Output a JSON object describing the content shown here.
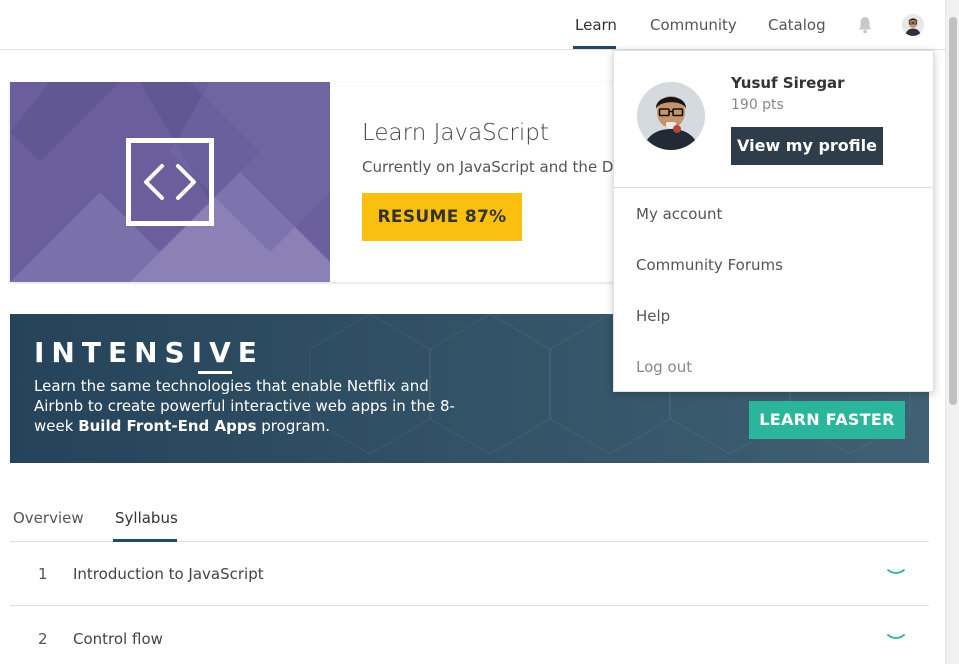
{
  "nav": {
    "links": [
      "Learn",
      "Community",
      "Catalog"
    ],
    "active": "Learn",
    "icons": [
      "bell-icon",
      "user-avatar"
    ]
  },
  "course": {
    "title": "Learn JavaScript",
    "subtitle": "Currently on JavaScript and the DOM",
    "resume_label": "RESUME 87%",
    "progress_percent": 87,
    "icon": "code-brackets-icon",
    "accent": "#fbbf0f"
  },
  "banner": {
    "title": "INTENSIVE",
    "text_before": "Learn the same technologies that enable Netflix and Airbnb to create powerful interactive web apps in the 8-week ",
    "text_bold": "Build Front-End Apps",
    "text_after": " program.",
    "cta": "LEARN FASTER",
    "cta_color": "#2bb59c"
  },
  "tabs": {
    "items": [
      "Overview",
      "Syllabus"
    ],
    "active": "Syllabus"
  },
  "syllabus": [
    {
      "num": "1",
      "title": "Introduction to JavaScript"
    },
    {
      "num": "2",
      "title": "Control flow"
    }
  ],
  "dropdown": {
    "name": "Yusuf Siregar",
    "points": "190 pts",
    "profile_button": "View my profile",
    "items": [
      "My account",
      "Community Forums",
      "Help",
      "Log out"
    ]
  }
}
